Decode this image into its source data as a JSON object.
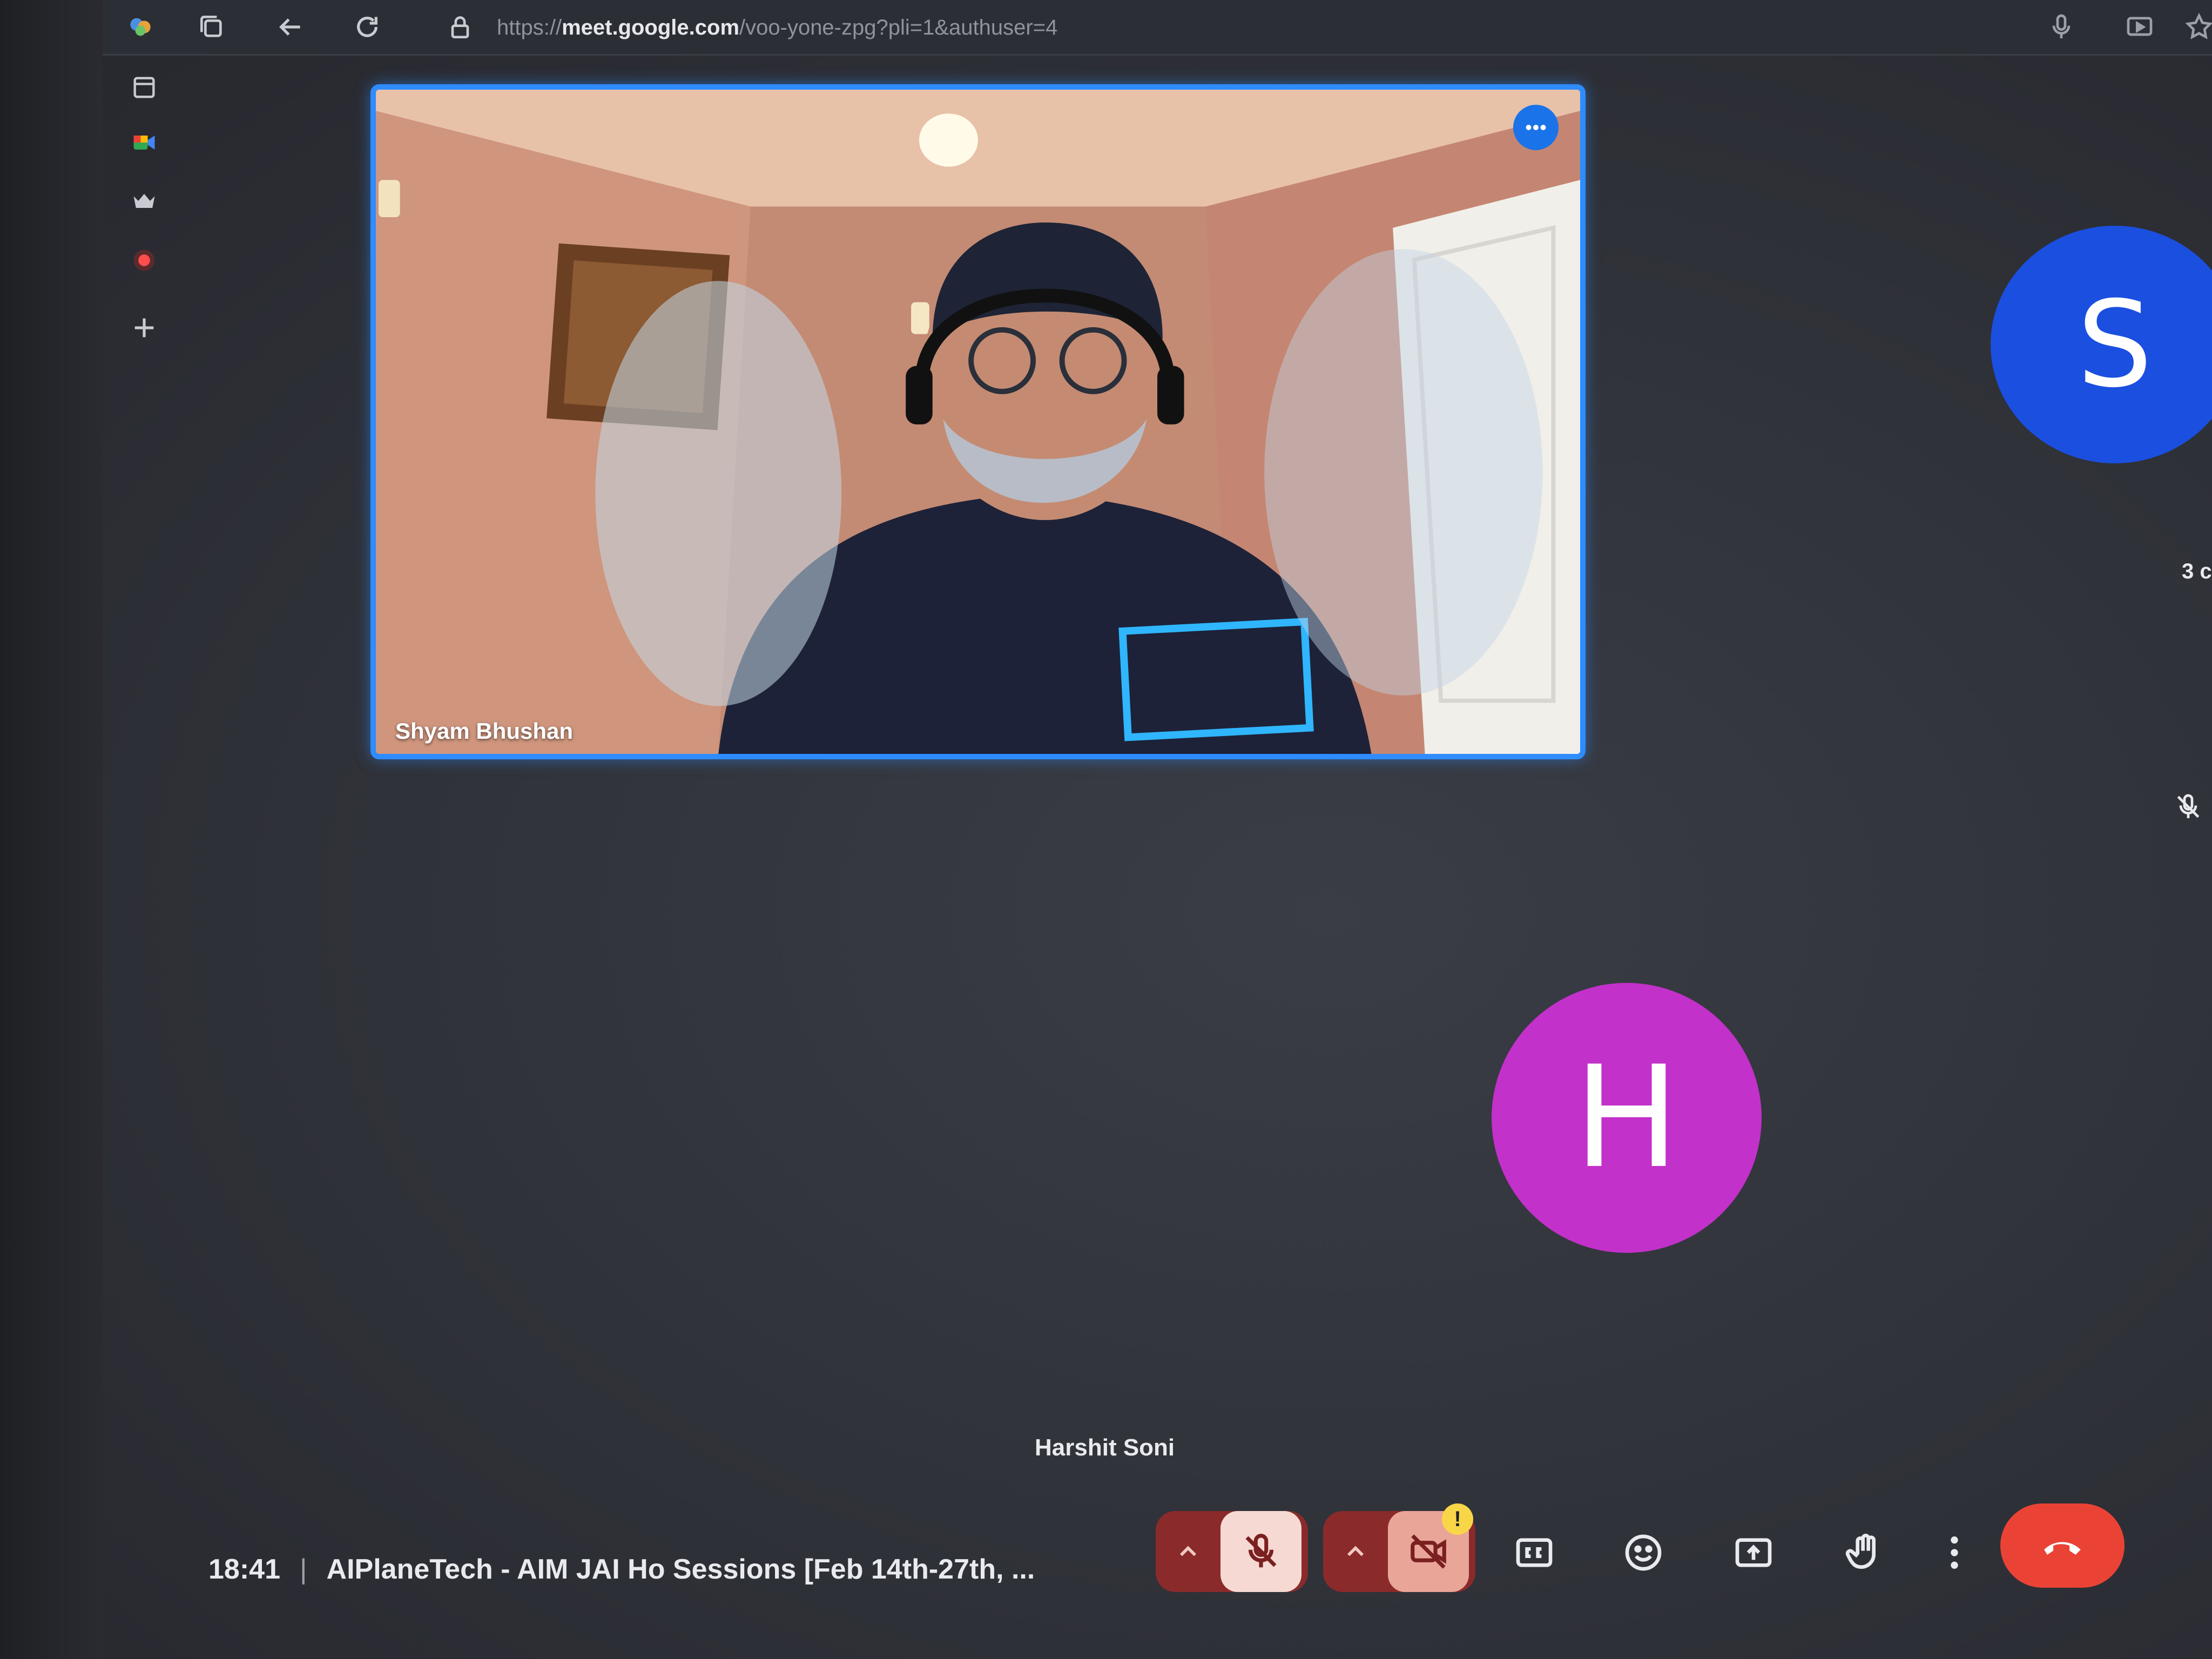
{
  "browser": {
    "url_scheme": "https://",
    "url_host": "meet.google.com",
    "url_path": "/voo-yone-zpg?pli=1&authuser=4"
  },
  "main_tile": {
    "participant_name": "Shyam Bhushan"
  },
  "side_participant": {
    "initial": "S",
    "count_text": "3 c",
    "color": "#1a4fe0"
  },
  "focus_participant": {
    "initial": "H",
    "name": "Harshit Soni",
    "color": "#c231c9"
  },
  "meeting": {
    "time": "18:41",
    "separator": "|",
    "title": "AIPlaneTech - AIM JAI Ho Sessions [Feb 14th-27th, ..."
  },
  "controls": {
    "camera_warning": "!",
    "hangup_color": "#ea4335"
  },
  "icons": {
    "toolbar": [
      "browser-logo-icon",
      "tabs-icon",
      "back-icon",
      "reload-icon",
      "lock-icon",
      "microphone-icon",
      "cast-icon",
      "bookmark-star-icon"
    ],
    "sidebar": [
      "panel-icon",
      "meet-icon",
      "crown-icon",
      "record-icon",
      "add-icon"
    ],
    "meeting": [
      "more-options-icon",
      "mic-off-icon",
      "camera-off-icon",
      "captions-icon",
      "emoji-icon",
      "present-icon",
      "raise-hand-icon",
      "more-vert-icon",
      "hangup-icon"
    ]
  }
}
